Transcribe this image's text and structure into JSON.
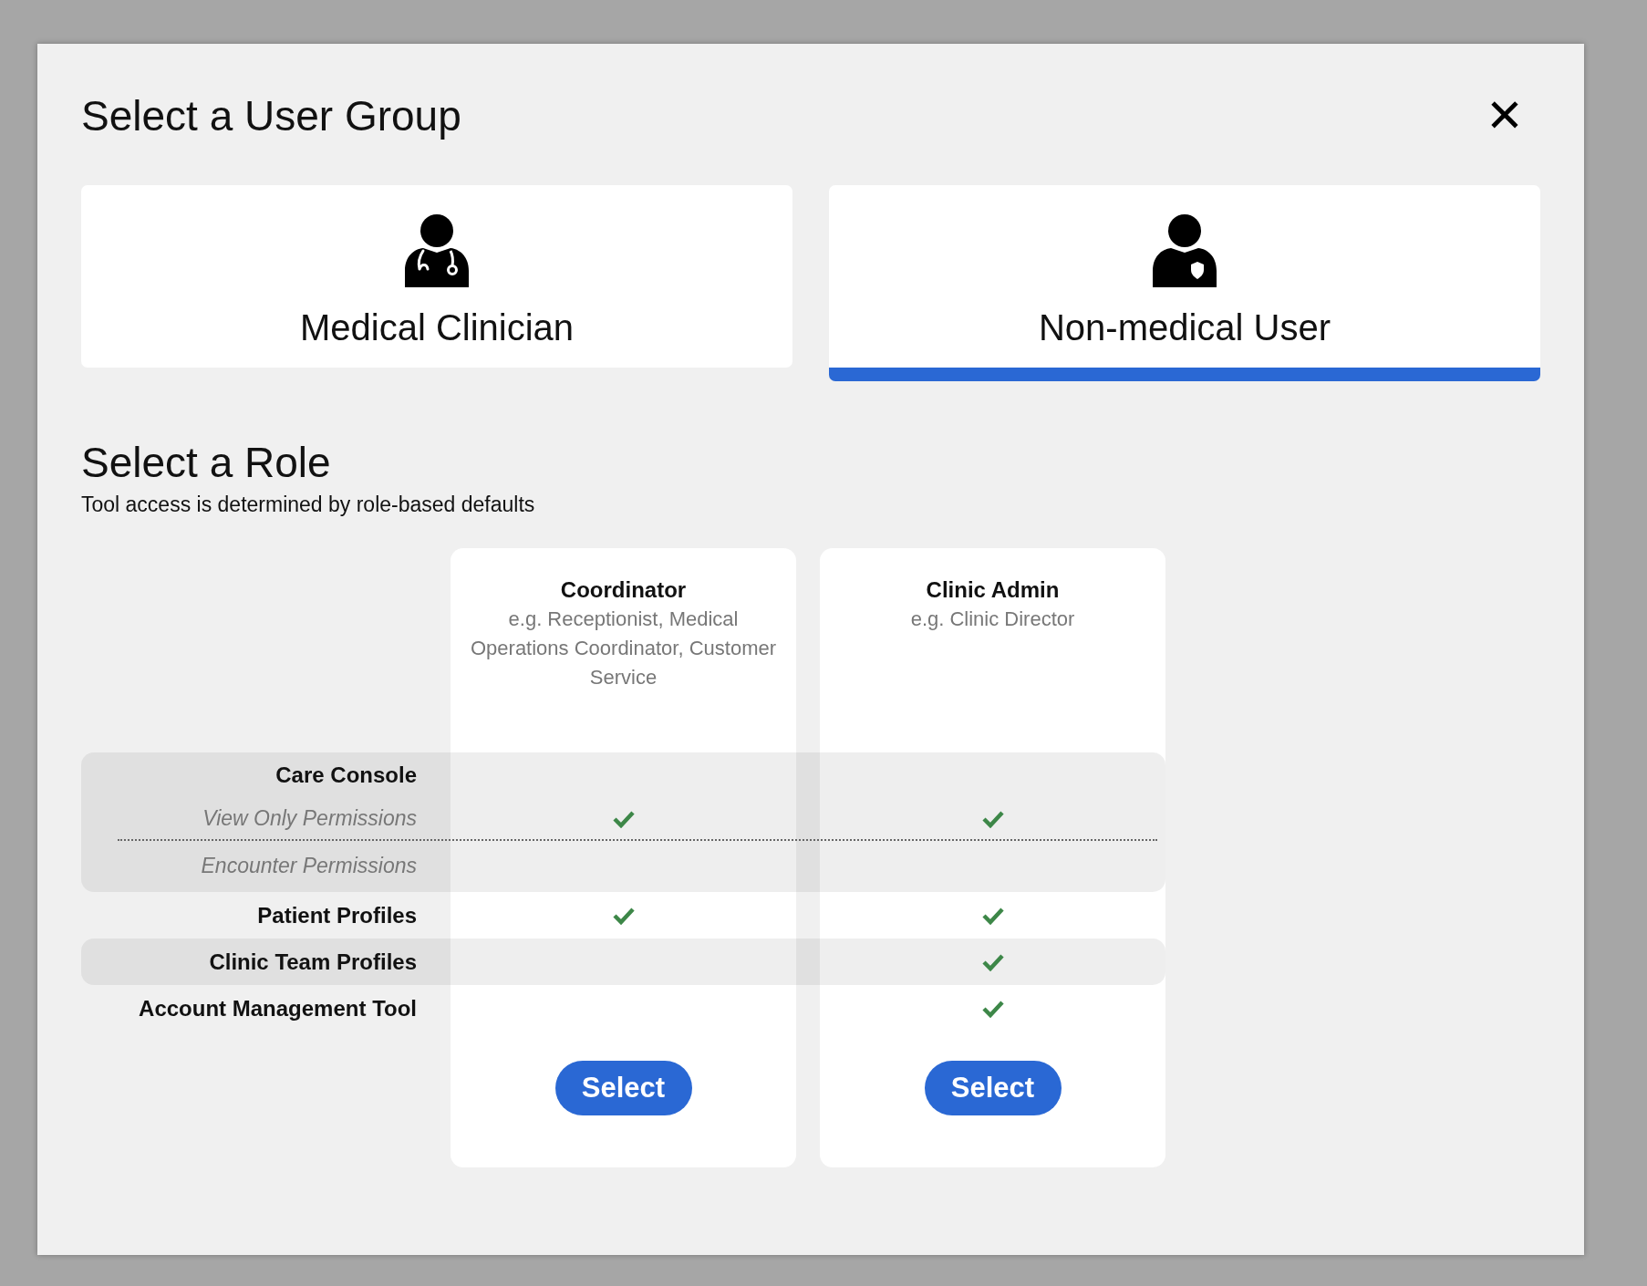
{
  "dialog": {
    "title": "Select a User Group",
    "close": "✕"
  },
  "groups": [
    {
      "label": "Medical Clinician",
      "kind": "clinician",
      "selected": false
    },
    {
      "label": "Non-medical User",
      "kind": "staff",
      "selected": true
    }
  ],
  "role_section": {
    "title": "Select a Role",
    "subtitle": "Tool access is determined by role-based defaults"
  },
  "roles": [
    {
      "name": "Coordinator",
      "examples": "e.g. Receptionist, Medical Operations Coordinator, Customer Service",
      "button": "Select"
    },
    {
      "name": "Clinic Admin",
      "examples": "e.g. Clinic Director",
      "button": "Select"
    }
  ],
  "features": [
    {
      "label": "Care Console",
      "kind": "group",
      "children": [
        {
          "label": "View Only Permissions",
          "checks": [
            {
              "checked": true
            },
            {
              "checked": true
            }
          ]
        },
        {
          "label": "Encounter Permissions",
          "checks": [
            {
              "checked": false
            },
            {
              "checked": false
            }
          ]
        }
      ]
    },
    {
      "label": "Patient Profiles",
      "kind": "feature",
      "checks": [
        {
          "checked": true
        },
        {
          "checked": true
        }
      ]
    },
    {
      "label": "Clinic Team Profiles",
      "kind": "feature",
      "checks": [
        {
          "checked": false
        },
        {
          "checked": true
        }
      ]
    },
    {
      "label": "Account Management Tool",
      "kind": "feature",
      "checks": [
        {
          "checked": false
        },
        {
          "checked": true
        }
      ]
    }
  ]
}
